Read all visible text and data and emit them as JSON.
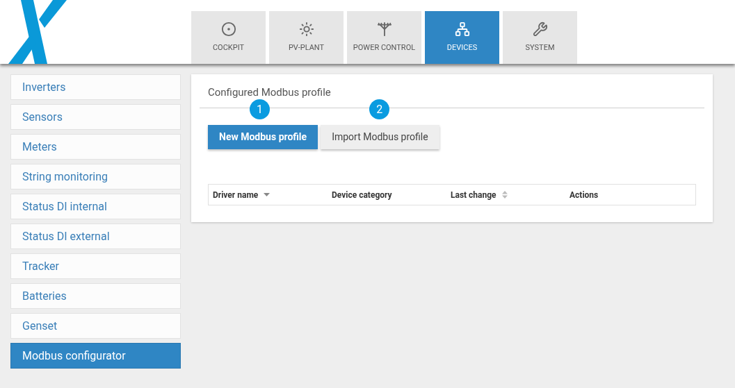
{
  "tabs": [
    {
      "label": "COCKPIT",
      "selected": false
    },
    {
      "label": "PV-PLANT",
      "selected": false
    },
    {
      "label": "POWER CONTROL",
      "selected": false
    },
    {
      "label": "DEVICES",
      "selected": true
    },
    {
      "label": "SYSTEM",
      "selected": false
    }
  ],
  "sidebar": {
    "items": [
      {
        "label": "Inverters",
        "selected": false
      },
      {
        "label": "Sensors",
        "selected": false
      },
      {
        "label": "Meters",
        "selected": false
      },
      {
        "label": "String monitoring",
        "selected": false
      },
      {
        "label": "Status DI internal",
        "selected": false
      },
      {
        "label": "Status DI external",
        "selected": false
      },
      {
        "label": "Tracker",
        "selected": false
      },
      {
        "label": "Batteries",
        "selected": false
      },
      {
        "label": "Genset",
        "selected": false
      },
      {
        "label": "Modbus configurator",
        "selected": true
      }
    ]
  },
  "panel": {
    "title": "Configured Modbus profile",
    "buttons": [
      {
        "label": "New Modbus profile",
        "kind": "primary",
        "callout": "1"
      },
      {
        "label": "Import Modbus profile",
        "kind": "secondary",
        "callout": "2"
      }
    ],
    "table": {
      "columns": [
        {
          "label": "Driver name",
          "kind": "sorted"
        },
        {
          "label": "Device category",
          "kind": "plain"
        },
        {
          "label": "Last change",
          "kind": "sortable"
        },
        {
          "label": "Actions",
          "kind": "plain"
        }
      ]
    }
  }
}
